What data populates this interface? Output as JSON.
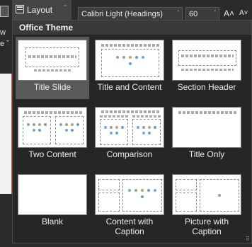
{
  "ribbon": {
    "new_slide_label_1": "w",
    "new_slide_label_2": "e ˇ",
    "layout_button_label": "Layout",
    "layout_caret": "ˇ",
    "font_name": "Calibri Light (Headings)",
    "font_caret": "ˇ",
    "font_size": "60",
    "size_caret": "ˇ",
    "grow_label": "A˄",
    "shrink_label": "A˅"
  },
  "dropdown": {
    "section_title": "Office Theme",
    "selected_index": 0,
    "layouts": [
      {
        "label": "Title Slide"
      },
      {
        "label": "Title and Content"
      },
      {
        "label": "Section Header"
      },
      {
        "label": "Two Content"
      },
      {
        "label": "Comparison"
      },
      {
        "label": "Title Only"
      },
      {
        "label": "Blank"
      },
      {
        "label": "Content with Caption"
      },
      {
        "label": "Picture with Caption"
      }
    ],
    "resize_glyph": "⠿"
  }
}
